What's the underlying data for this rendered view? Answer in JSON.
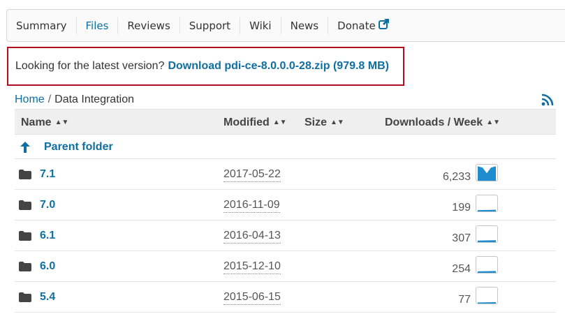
{
  "tabs": [
    {
      "label": "Summary",
      "active": false
    },
    {
      "label": "Files",
      "active": true
    },
    {
      "label": "Reviews",
      "active": false
    },
    {
      "label": "Support",
      "active": false
    },
    {
      "label": "Wiki",
      "active": false
    },
    {
      "label": "News",
      "active": false
    },
    {
      "label": "Donate",
      "active": false,
      "icon": "external-link-icon"
    }
  ],
  "notice": {
    "prefix": "Looking for the latest version?",
    "link_text": "Download pdi-ce-8.0.0.0-28.zip (979.8 MB)"
  },
  "breadcrumb": {
    "home": "Home",
    "separator": "/",
    "current": "Data Integration"
  },
  "table": {
    "headers": {
      "name": "Name",
      "modified": "Modified",
      "size": "Size",
      "downloads": "Downloads / Week"
    },
    "sort_icon": "sort-updown-icon",
    "parent_label": "Parent folder",
    "rows": [
      {
        "name": "7.1",
        "modified": "2017-05-22",
        "size": "",
        "downloads": "6,233",
        "spark_level": 0.9
      },
      {
        "name": "7.0",
        "modified": "2016-11-09",
        "size": "",
        "downloads": "199",
        "spark_level": 0.08
      },
      {
        "name": "6.1",
        "modified": "2016-04-13",
        "size": "",
        "downloads": "307",
        "spark_level": 0.1
      },
      {
        "name": "6.0",
        "modified": "2015-12-10",
        "size": "",
        "downloads": "254",
        "spark_level": 0.09
      },
      {
        "name": "5.4",
        "modified": "2015-06-15",
        "size": "",
        "downloads": "77",
        "spark_level": 0.05
      }
    ]
  },
  "colors": {
    "link": "#0e6fa0",
    "notice_border": "#b00d1f",
    "spark_fill": "#1f8ccf"
  }
}
